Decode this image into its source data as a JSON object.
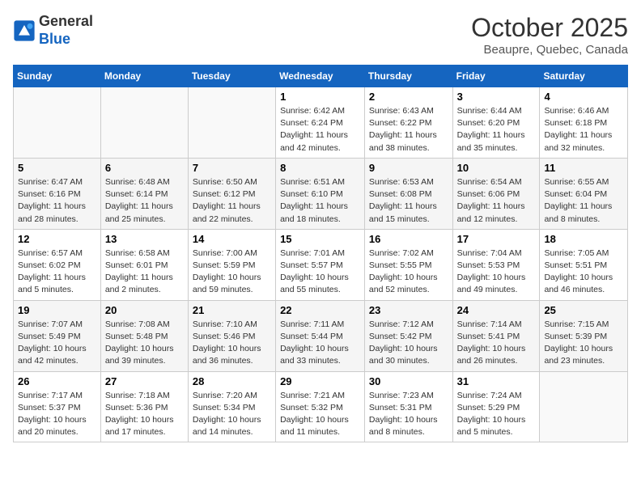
{
  "logo": {
    "line1": "General",
    "line2": "Blue"
  },
  "title": "October 2025",
  "subtitle": "Beaupre, Quebec, Canada",
  "weekdays": [
    "Sunday",
    "Monday",
    "Tuesday",
    "Wednesday",
    "Thursday",
    "Friday",
    "Saturday"
  ],
  "weeks": [
    [
      {
        "day": "",
        "info": ""
      },
      {
        "day": "",
        "info": ""
      },
      {
        "day": "",
        "info": ""
      },
      {
        "day": "1",
        "info": "Sunrise: 6:42 AM\nSunset: 6:24 PM\nDaylight: 11 hours and 42 minutes."
      },
      {
        "day": "2",
        "info": "Sunrise: 6:43 AM\nSunset: 6:22 PM\nDaylight: 11 hours and 38 minutes."
      },
      {
        "day": "3",
        "info": "Sunrise: 6:44 AM\nSunset: 6:20 PM\nDaylight: 11 hours and 35 minutes."
      },
      {
        "day": "4",
        "info": "Sunrise: 6:46 AM\nSunset: 6:18 PM\nDaylight: 11 hours and 32 minutes."
      }
    ],
    [
      {
        "day": "5",
        "info": "Sunrise: 6:47 AM\nSunset: 6:16 PM\nDaylight: 11 hours and 28 minutes."
      },
      {
        "day": "6",
        "info": "Sunrise: 6:48 AM\nSunset: 6:14 PM\nDaylight: 11 hours and 25 minutes."
      },
      {
        "day": "7",
        "info": "Sunrise: 6:50 AM\nSunset: 6:12 PM\nDaylight: 11 hours and 22 minutes."
      },
      {
        "day": "8",
        "info": "Sunrise: 6:51 AM\nSunset: 6:10 PM\nDaylight: 11 hours and 18 minutes."
      },
      {
        "day": "9",
        "info": "Sunrise: 6:53 AM\nSunset: 6:08 PM\nDaylight: 11 hours and 15 minutes."
      },
      {
        "day": "10",
        "info": "Sunrise: 6:54 AM\nSunset: 6:06 PM\nDaylight: 11 hours and 12 minutes."
      },
      {
        "day": "11",
        "info": "Sunrise: 6:55 AM\nSunset: 6:04 PM\nDaylight: 11 hours and 8 minutes."
      }
    ],
    [
      {
        "day": "12",
        "info": "Sunrise: 6:57 AM\nSunset: 6:02 PM\nDaylight: 11 hours and 5 minutes."
      },
      {
        "day": "13",
        "info": "Sunrise: 6:58 AM\nSunset: 6:01 PM\nDaylight: 11 hours and 2 minutes."
      },
      {
        "day": "14",
        "info": "Sunrise: 7:00 AM\nSunset: 5:59 PM\nDaylight: 10 hours and 59 minutes."
      },
      {
        "day": "15",
        "info": "Sunrise: 7:01 AM\nSunset: 5:57 PM\nDaylight: 10 hours and 55 minutes."
      },
      {
        "day": "16",
        "info": "Sunrise: 7:02 AM\nSunset: 5:55 PM\nDaylight: 10 hours and 52 minutes."
      },
      {
        "day": "17",
        "info": "Sunrise: 7:04 AM\nSunset: 5:53 PM\nDaylight: 10 hours and 49 minutes."
      },
      {
        "day": "18",
        "info": "Sunrise: 7:05 AM\nSunset: 5:51 PM\nDaylight: 10 hours and 46 minutes."
      }
    ],
    [
      {
        "day": "19",
        "info": "Sunrise: 7:07 AM\nSunset: 5:49 PM\nDaylight: 10 hours and 42 minutes."
      },
      {
        "day": "20",
        "info": "Sunrise: 7:08 AM\nSunset: 5:48 PM\nDaylight: 10 hours and 39 minutes."
      },
      {
        "day": "21",
        "info": "Sunrise: 7:10 AM\nSunset: 5:46 PM\nDaylight: 10 hours and 36 minutes."
      },
      {
        "day": "22",
        "info": "Sunrise: 7:11 AM\nSunset: 5:44 PM\nDaylight: 10 hours and 33 minutes."
      },
      {
        "day": "23",
        "info": "Sunrise: 7:12 AM\nSunset: 5:42 PM\nDaylight: 10 hours and 30 minutes."
      },
      {
        "day": "24",
        "info": "Sunrise: 7:14 AM\nSunset: 5:41 PM\nDaylight: 10 hours and 26 minutes."
      },
      {
        "day": "25",
        "info": "Sunrise: 7:15 AM\nSunset: 5:39 PM\nDaylight: 10 hours and 23 minutes."
      }
    ],
    [
      {
        "day": "26",
        "info": "Sunrise: 7:17 AM\nSunset: 5:37 PM\nDaylight: 10 hours and 20 minutes."
      },
      {
        "day": "27",
        "info": "Sunrise: 7:18 AM\nSunset: 5:36 PM\nDaylight: 10 hours and 17 minutes."
      },
      {
        "day": "28",
        "info": "Sunrise: 7:20 AM\nSunset: 5:34 PM\nDaylight: 10 hours and 14 minutes."
      },
      {
        "day": "29",
        "info": "Sunrise: 7:21 AM\nSunset: 5:32 PM\nDaylight: 10 hours and 11 minutes."
      },
      {
        "day": "30",
        "info": "Sunrise: 7:23 AM\nSunset: 5:31 PM\nDaylight: 10 hours and 8 minutes."
      },
      {
        "day": "31",
        "info": "Sunrise: 7:24 AM\nSunset: 5:29 PM\nDaylight: 10 hours and 5 minutes."
      },
      {
        "day": "",
        "info": ""
      }
    ]
  ]
}
